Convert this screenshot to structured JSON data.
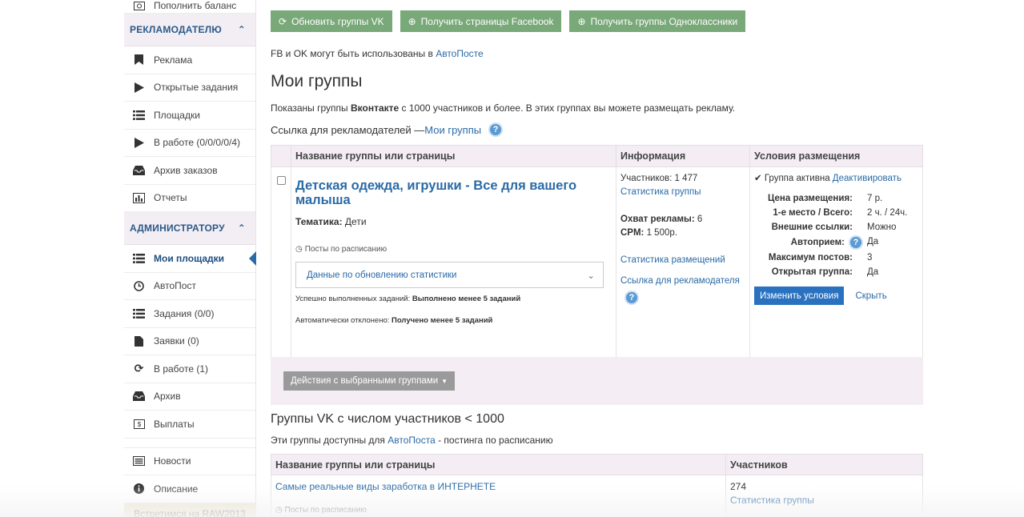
{
  "sidebar": {
    "top_item": "Пополнить баланс",
    "section_advertiser": "РЕКЛАМОДАТЕЛЮ",
    "advertiser_items": [
      {
        "label": "Реклама",
        "icon": "bookmark-icon"
      },
      {
        "label": "Открытые задания",
        "icon": "play-icon"
      },
      {
        "label": "Площадки",
        "icon": "list-icon"
      },
      {
        "label": "В работе (0/0/0/0/4)",
        "icon": "play-icon"
      },
      {
        "label": "Архив заказов",
        "icon": "inbox-icon"
      },
      {
        "label": "Отчеты",
        "icon": "chart-icon"
      }
    ],
    "section_admin": "АДМИНИСТРАТОРУ",
    "admin_items": [
      {
        "label": "Мои площадки",
        "icon": "list-icon"
      },
      {
        "label": "АвтоПост",
        "icon": "clock-icon"
      },
      {
        "label": "Задания (0/0)",
        "icon": "list-icon"
      },
      {
        "label": "Заявки (0)",
        "icon": "file-icon"
      },
      {
        "label": "В работе (1)",
        "icon": "refresh-icon"
      },
      {
        "label": "Архив",
        "icon": "inbox-icon"
      },
      {
        "label": "Выплаты",
        "icon": "money-icon"
      }
    ],
    "bottom_items": [
      {
        "label": "Новости",
        "icon": "news-icon"
      },
      {
        "label": "Описание",
        "icon": "info-icon"
      }
    ],
    "promo": "Встретимся на RAW2013"
  },
  "toolbar": {
    "btn_vk": "Обновить группы VK",
    "btn_fb": "Получить страницы Facebook",
    "btn_ok": "Получить группы Одноклассники"
  },
  "note": {
    "text": "FB и OK могут быть использованы в ",
    "link": "АвтоПосте"
  },
  "page_title": "Мои группы",
  "desc": {
    "pre": "Показаны группы ",
    "bold": "Вконтакте",
    "post": " с 1000 участников и более. В этих группах вы можете размещать рекламу."
  },
  "adv_link": {
    "pre": "Ссылка для рекламодателей — ",
    "link": "Мои группы"
  },
  "table1": {
    "headers": [
      "Название группы или страницы",
      "Информация",
      "Условия размещения"
    ],
    "row": {
      "title": "Детская одежда, игрушки - Все для вашего малыша",
      "theme_label": "Тематика:",
      "theme_value": "Дети",
      "schedule": "Посты по расписанию",
      "dropdown": "Данные по обновлению статистики",
      "done_label": "Успешно выполненных заданий:",
      "done_value": "Выполнено менее 5 заданий",
      "rejected_label": "Автоматически отклонено:",
      "rejected_value": "Получено менее 5 заданий",
      "members": "Участников: 1 477",
      "group_stats": "Статистика группы",
      "reach_label": "Охват рекламы:",
      "reach_value": "6",
      "cpm_label": "CPM:",
      "cpm_value": "1 500р.",
      "placement_stats": "Статистика размещений",
      "adv_link": "Ссылка для рекламодателя",
      "status_text": "Группа активна",
      "deactivate": "Деактивировать",
      "conditions": [
        {
          "k": "Цена размещения:",
          "v": "7 р."
        },
        {
          "k": "1-е место / Всего:",
          "v": "2 ч. / 24ч."
        },
        {
          "k": "Внешние ссылки:",
          "v": "Можно"
        },
        {
          "k": "Автоприем:",
          "v": "Да"
        },
        {
          "k": "Максимум постов:",
          "v": "3"
        },
        {
          "k": "Открытая группа:",
          "v": "Да"
        }
      ],
      "change_btn": "Изменить условия",
      "hide": "Скрыть"
    }
  },
  "actions_btn": "Действия с выбранными группами",
  "section2_title": "Группы VK с числом участников < 1000",
  "desc2": {
    "pre": "Эти группы доступны для ",
    "link": "АвтоПоста",
    "post": " - постинга по расписанию"
  },
  "table2": {
    "headers": [
      "Название группы или страницы",
      "Участников"
    ],
    "row": {
      "title": "Самые реальные виды заработка в ИНТЕРНЕТЕ",
      "schedule": "Посты по расписанию",
      "members": "274",
      "stats": "Статистика группы"
    }
  }
}
